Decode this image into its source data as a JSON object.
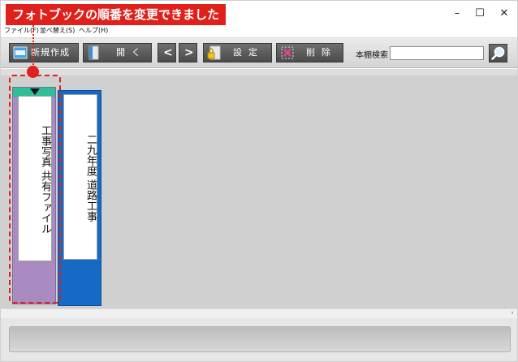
{
  "callout": {
    "text": "フォトブックの順番を変更できました"
  },
  "window": {
    "minimize": "–",
    "maximize": "☐",
    "close": "✕"
  },
  "menu": {
    "file": "ファイル(F)",
    "sort": "並べ替え(S)",
    "help": "ヘルプ(H)"
  },
  "toolbar": {
    "new_label": "新規作成",
    "open_label": "開く",
    "prev_label": "<",
    "next_label": ">",
    "settings_label": "設定",
    "delete_label": "削除",
    "search_label": "本棚検索",
    "search_value": ""
  },
  "books": [
    {
      "title": "工事写真 共有ファイル",
      "color": "#a98bc2",
      "selected": true
    },
    {
      "title": "二九年度 道路工事",
      "color": "#1669c4",
      "selected": false
    }
  ],
  "colors": {
    "accent": "#e0201a",
    "selected_border": "#2fbf98",
    "shelf_bg": "#d0d0d0"
  },
  "icons": {
    "new": "new-icon",
    "open": "open-book-icon",
    "settings": "lock-icon",
    "delete": "delete-icon",
    "search": "magnifier-icon"
  },
  "scroll": {
    "right_arrow": "›"
  }
}
